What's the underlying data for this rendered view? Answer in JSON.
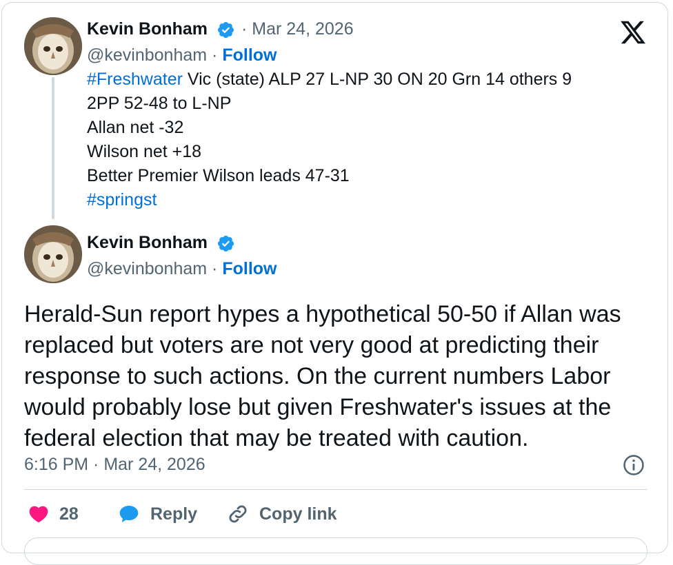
{
  "first_post": {
    "author_name": "Kevin Bonham",
    "handle": "@kevinbonham",
    "separator_dot": "·",
    "date": "Mar 24, 2026",
    "follow_label": "Follow",
    "hashtag_freshwater": "#Freshwater",
    "line1_rest": " Vic (state) ALP 27 L-NP 30 ON 20 Grn 14 others 9",
    "line2": "2PP 52-48 to L-NP",
    "line3": "Allan net -32",
    "line4": "Wilson net +18",
    "line5": "Better Premier Wilson leads 47-31",
    "hashtag_springst": "#springst"
  },
  "second_post": {
    "author_name": "Kevin Bonham",
    "handle": "@kevinbonham",
    "separator_dot": "·",
    "follow_label": "Follow",
    "text_lines": [
      "Herald-Sun report hypes a hypothetical 50-50 if Allan was",
      "replaced but voters are not very good at predicting their",
      "response to such actions.  On the current numbers Labor",
      "would probably lose but given Freshwater's issues at the",
      "federal election that may be treated with caution."
    ],
    "timestamp": "6:16 PM · Mar 24, 2026"
  },
  "actions": {
    "like_count": "28",
    "reply_label": "Reply",
    "copy_link_label": "Copy link"
  },
  "colors": {
    "link_blue": "#006fd6",
    "verified_blue": "#1d9bf0",
    "like_pink": "#f91880",
    "muted_gray": "#536471",
    "border": "#cfd9de"
  },
  "icons": [
    "verified-badge-icon",
    "x-logo-icon",
    "info-icon",
    "heart-icon",
    "reply-bubble-icon",
    "link-icon"
  ]
}
